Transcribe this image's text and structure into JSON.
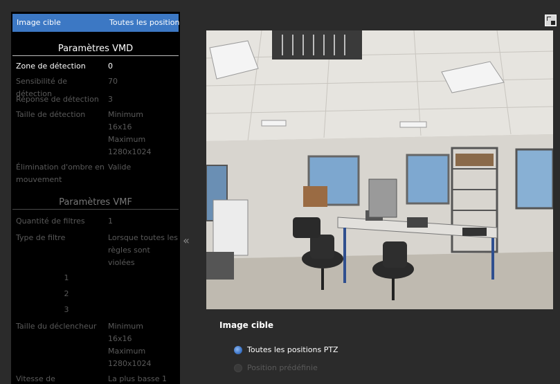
{
  "sidebar": {
    "header": {
      "label": "Image cible",
      "value": "Toutes les position"
    },
    "vmd": {
      "title": "Paramètres VMD",
      "rows": [
        {
          "label": "Zone de détection",
          "value": "0"
        },
        {
          "label": "Sensibilité de détection",
          "value": "70"
        },
        {
          "label": "Réponse de détection",
          "value": "3"
        },
        {
          "label": "Taille de détection",
          "value": "Minimum 16x16 Maximum 1280x1024"
        },
        {
          "label": "Élimination d'ombre en mouvement",
          "value": "Valide"
        }
      ]
    },
    "vmf": {
      "title": "Paramètres VMF",
      "rows": [
        {
          "label": "Quantité de filtres",
          "value": "1"
        },
        {
          "label": "Type de filtre",
          "value": "Lorsque toutes les règles sont violées"
        }
      ],
      "numbers": [
        "1",
        "2",
        "3"
      ],
      "rows2": [
        {
          "label": "Taille du déclencheur",
          "value": "Minimum 16x16 Maximum 1280x1024"
        },
        {
          "label": "Vitesse de déclencheur",
          "value": "La plus basse 1"
        }
      ]
    }
  },
  "collapse_glyph": "«",
  "main": {
    "target_title": "Image cible",
    "options": [
      {
        "label": "Toutes les positions PTZ",
        "selected": true
      },
      {
        "label": "Position prédéfinie",
        "selected": false
      }
    ]
  },
  "colors": {
    "accent": "#3c78c4",
    "panel_bg": "#000000",
    "page_bg": "#2b2b2b",
    "dim_text": "#5a5a5a"
  },
  "icons": {
    "collapse": "double-chevron-left-icon",
    "expand": "fullscreen-icon"
  }
}
